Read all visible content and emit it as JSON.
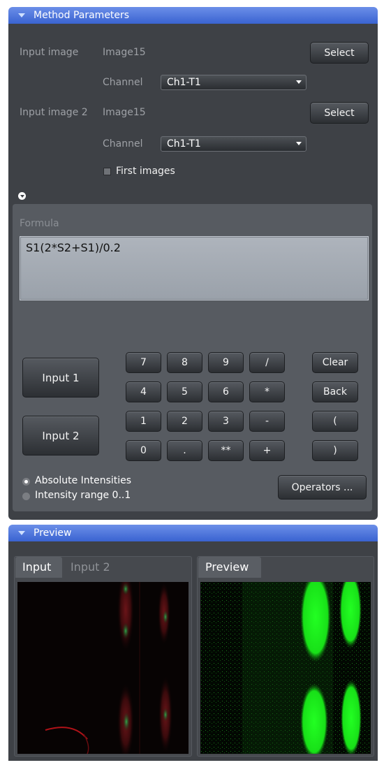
{
  "method_parameters": {
    "header": "Method Parameters",
    "input_image": {
      "label": "Input image",
      "value": "Image15",
      "select_label": "Select",
      "channel_label": "Channel",
      "channel_value": "Ch1-T1"
    },
    "input_image_2": {
      "label": "Input image 2",
      "value": "Image15",
      "select_label": "Select",
      "channel_label": "Channel",
      "channel_value": "Ch1-T1"
    },
    "first_images_label": "First images",
    "first_images_checked": false
  },
  "formula": {
    "label": "Formula",
    "value": "S1(2*S2+S1)/0.2"
  },
  "input_buttons": {
    "input1": "Input 1",
    "input2": "Input 2"
  },
  "keypad": [
    [
      "7",
      "8",
      "9",
      "/"
    ],
    [
      "4",
      "5",
      "6",
      "*"
    ],
    [
      "1",
      "2",
      "3",
      "-"
    ],
    [
      "0",
      ".",
      "**",
      "+"
    ]
  ],
  "side_keys": [
    "Clear",
    "Back",
    "(",
    ")"
  ],
  "intensity_mode": {
    "options": [
      "Absolute Intensities",
      "Intensity range 0..1"
    ],
    "selected": "Absolute Intensities"
  },
  "operators_label": "Operators ...",
  "preview": {
    "header": "Preview",
    "left_tabs": [
      "Input",
      "Input 2"
    ],
    "left_active_tab": "Input",
    "right_tabs": [
      "Preview"
    ],
    "right_active_tab": "Preview"
  },
  "colors": {
    "header_blue": "#3a63d1",
    "panel_bg": "#3e4146",
    "formula_bg": "#a4aab2",
    "input_channel_red": "#c0181e",
    "preview_green": "#22ff22"
  }
}
